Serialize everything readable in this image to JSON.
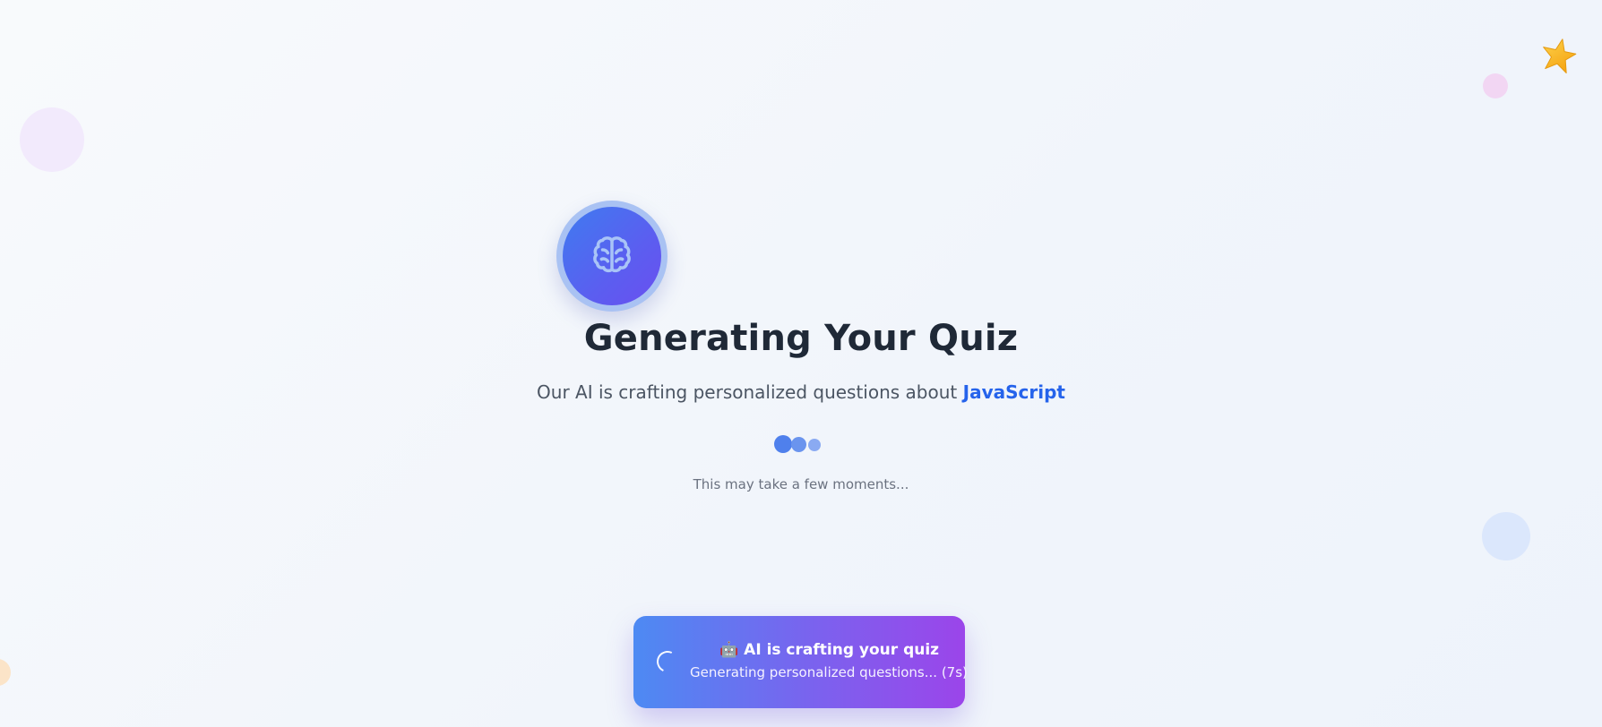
{
  "loading_screen": {
    "title": "Generating Your Quiz",
    "subtitle_prefix": "Our AI is crafting personalized questions about ",
    "topic": "JavaScript",
    "hint": "This may take a few moments..."
  },
  "toast": {
    "emoji": "🤖",
    "title": "AI is crafting your quiz",
    "status": "Generating personalized questions... (7s)"
  },
  "icons": {
    "badge": "brain-icon",
    "corner": "star-icon",
    "spinner": "spinner-icon"
  },
  "colors": {
    "accent_blue": "#2563eb",
    "title": "#1f2937",
    "toast_gradient_start": "#4d8af3",
    "toast_gradient_end": "#9b45ea"
  }
}
